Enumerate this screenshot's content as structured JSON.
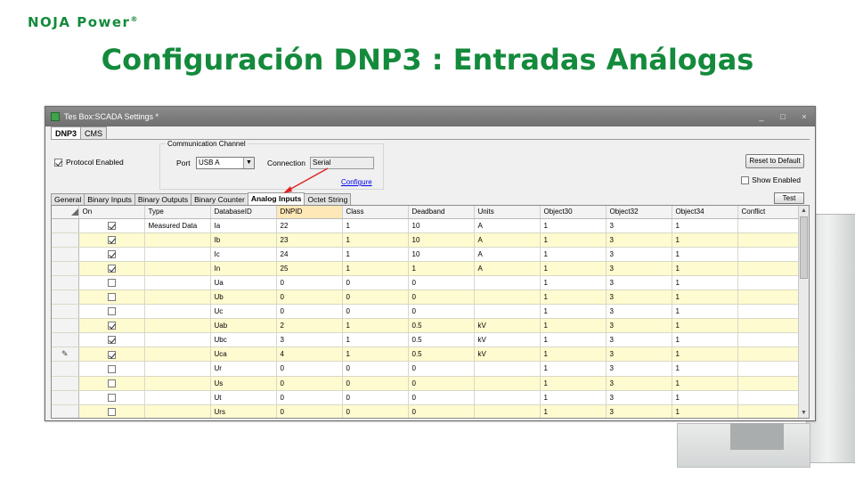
{
  "brand": {
    "name": "NOJA Power",
    "mark": "®"
  },
  "title": "Configuración DNP3 : Entradas Análogas",
  "window": {
    "title": "Tes Box:SCADA Settings *",
    "controls": [
      "_",
      "□",
      "×"
    ]
  },
  "top_tabs": [
    {
      "label": "DNP3",
      "active": true
    },
    {
      "label": "CMS",
      "active": false
    }
  ],
  "protocol_enabled": {
    "label": "Protocol Enabled",
    "checked": true
  },
  "comm": {
    "legend": "Communication Channel",
    "port_label": "Port",
    "port_value": "USB A",
    "connection_label": "Connection",
    "connection_value": "Serial",
    "configure_label": "Configure"
  },
  "reset_label": "Reset to Default",
  "show_enabled": {
    "label": "Show Enabled",
    "checked": false
  },
  "sub_tabs": [
    {
      "label": "General",
      "active": false
    },
    {
      "label": "Binary Inputs",
      "active": false
    },
    {
      "label": "Binary Outputs",
      "active": false
    },
    {
      "label": "Binary Counter",
      "active": false
    },
    {
      "label": "Analog Inputs",
      "active": true
    },
    {
      "label": "Octet String",
      "active": false
    }
  ],
  "test_label": "Test",
  "grid": {
    "columns": [
      "On",
      "Type",
      "DatabaseID",
      "DNPID",
      "Class",
      "Deadband",
      "Units",
      "Object30",
      "Object32",
      "Object34",
      "Conflict"
    ],
    "highlight_column": "DNPID",
    "rows": [
      {
        "marker": "",
        "on": true,
        "type": "Measured Data",
        "db": "Ia",
        "dnpid": "22",
        "cls": "1",
        "deadband": "10",
        "units": "A",
        "o30": "1",
        "o32": "3",
        "o34": "1",
        "conflict": ""
      },
      {
        "marker": "",
        "on": true,
        "type": "",
        "db": "Ib",
        "dnpid": "23",
        "cls": "1",
        "deadband": "10",
        "units": "A",
        "o30": "1",
        "o32": "3",
        "o34": "1",
        "conflict": ""
      },
      {
        "marker": "",
        "on": true,
        "type": "",
        "db": "Ic",
        "dnpid": "24",
        "cls": "1",
        "deadband": "10",
        "units": "A",
        "o30": "1",
        "o32": "3",
        "o34": "1",
        "conflict": ""
      },
      {
        "marker": "",
        "on": true,
        "type": "",
        "db": "In",
        "dnpid": "25",
        "cls": "1",
        "deadband": "1",
        "units": "A",
        "o30": "1",
        "o32": "3",
        "o34": "1",
        "conflict": ""
      },
      {
        "marker": "",
        "on": false,
        "type": "",
        "db": "Ua",
        "dnpid": "0",
        "cls": "0",
        "deadband": "0",
        "units": "",
        "o30": "1",
        "o32": "3",
        "o34": "1",
        "conflict": ""
      },
      {
        "marker": "",
        "on": false,
        "type": "",
        "db": "Ub",
        "dnpid": "0",
        "cls": "0",
        "deadband": "0",
        "units": "",
        "o30": "1",
        "o32": "3",
        "o34": "1",
        "conflict": ""
      },
      {
        "marker": "",
        "on": false,
        "type": "",
        "db": "Uc",
        "dnpid": "0",
        "cls": "0",
        "deadband": "0",
        "units": "",
        "o30": "1",
        "o32": "3",
        "o34": "1",
        "conflict": ""
      },
      {
        "marker": "",
        "on": true,
        "type": "",
        "db": "Uab",
        "dnpid": "2",
        "cls": "1",
        "deadband": "0.5",
        "units": "kV",
        "o30": "1",
        "o32": "3",
        "o34": "1",
        "conflict": ""
      },
      {
        "marker": "",
        "on": true,
        "type": "",
        "db": "Ubc",
        "dnpid": "3",
        "cls": "1",
        "deadband": "0.5",
        "units": "kV",
        "o30": "1",
        "o32": "3",
        "o34": "1",
        "conflict": ""
      },
      {
        "marker": "✎",
        "on": true,
        "type": "",
        "db": "Uca",
        "dnpid": "4",
        "cls": "1",
        "deadband": "0.5",
        "units": "kV",
        "o30": "1",
        "o32": "3",
        "o34": "1",
        "conflict": ""
      },
      {
        "marker": "",
        "on": false,
        "type": "",
        "db": "Ur",
        "dnpid": "0",
        "cls": "0",
        "deadband": "0",
        "units": "",
        "o30": "1",
        "o32": "3",
        "o34": "1",
        "conflict": ""
      },
      {
        "marker": "",
        "on": false,
        "type": "",
        "db": "Us",
        "dnpid": "0",
        "cls": "0",
        "deadband": "0",
        "units": "",
        "o30": "1",
        "o32": "3",
        "o34": "1",
        "conflict": ""
      },
      {
        "marker": "",
        "on": false,
        "type": "",
        "db": "Ut",
        "dnpid": "0",
        "cls": "0",
        "deadband": "0",
        "units": "",
        "o30": "1",
        "o32": "3",
        "o34": "1",
        "conflict": ""
      },
      {
        "marker": "",
        "on": false,
        "type": "",
        "db": "Urs",
        "dnpid": "0",
        "cls": "0",
        "deadband": "0",
        "units": "",
        "o30": "1",
        "o32": "3",
        "o34": "1",
        "conflict": ""
      }
    ]
  }
}
